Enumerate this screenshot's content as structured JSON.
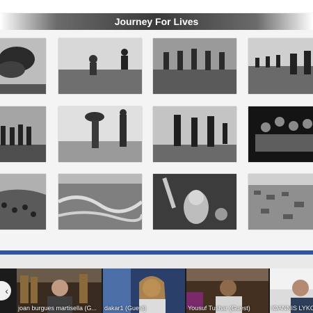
{
  "presentation": {
    "title": "Journey For Lives"
  },
  "gallery": {
    "photos": [
      {
        "subject": "smoke-plume-photo"
      },
      {
        "subject": "people-crossing-bank-photo"
      },
      {
        "subject": "refugees-walking-mud-photo"
      },
      {
        "subject": "crowd-on-riverbank-photo"
      },
      {
        "subject": "group-standing-field-photo"
      },
      {
        "subject": "woman-with-umbrella-in-rain-photo"
      },
      {
        "subject": "men-carrying-loads-photo"
      },
      {
        "subject": "night-boat-group-photo"
      },
      {
        "subject": "hillside-camp-photo"
      },
      {
        "subject": "aerial-river-photo"
      },
      {
        "subject": "child-raising-arm-photo"
      },
      {
        "subject": "aerial-settlement-photo"
      }
    ]
  },
  "meeting": {
    "prev_label": "‹",
    "participants": [
      {
        "name": "joan burgues martisella (G..."
      },
      {
        "name": "dakar1 (Guest)"
      },
      {
        "name": "Yousuf Tushar (Guest)"
      },
      {
        "name": "IOANNIS LYKO..."
      }
    ]
  }
}
